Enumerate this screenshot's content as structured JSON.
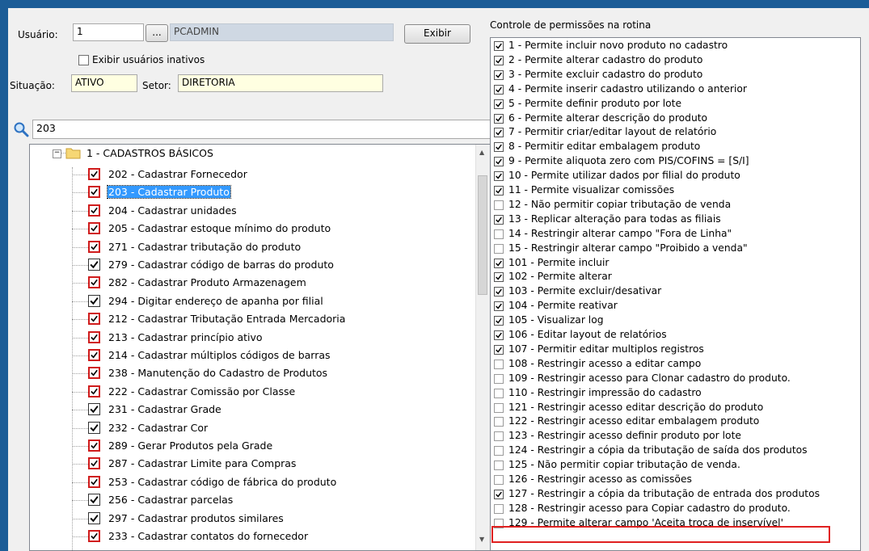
{
  "form": {
    "usuario_label": "Usuário:",
    "usuario_value": "1",
    "lookup_button": "...",
    "usuario_nome": "PCADMIN",
    "exibir_button": "Exibir",
    "inativos_label": "Exibir usuários inativos",
    "situacao_label": "Situação:",
    "situacao_value": "ATIVO",
    "setor_label": "Setor:",
    "setor_value": "DIRETORIA",
    "search_value": "203"
  },
  "tree": {
    "root_label": "1 - CADASTROS BÁSICOS",
    "items": [
      {
        "label": "202 - Cadastrar  Fornecedor",
        "red": true
      },
      {
        "label": "203 - Cadastrar  Produto",
        "red": true,
        "selected": true
      },
      {
        "label": "204 - Cadastrar unidades",
        "red": true
      },
      {
        "label": "205 - Cadastrar estoque mínimo do produto",
        "red": true
      },
      {
        "label": "271 - Cadastrar tributação do produto",
        "red": true
      },
      {
        "label": "279 - Cadastrar código de barras do produto",
        "red": false
      },
      {
        "label": "282 - Cadastrar Produto Armazenagem",
        "red": true
      },
      {
        "label": "294 - Digitar endereço de apanha por filial",
        "red": false
      },
      {
        "label": "212 - Cadastrar Tributação Entrada Mercadoria",
        "red": true
      },
      {
        "label": "213 - Cadastrar princípio ativo",
        "red": true
      },
      {
        "label": "214 - Cadastrar múltiplos códigos de barras",
        "red": true
      },
      {
        "label": "238 - Manutenção do Cadastro de Produtos",
        "red": true
      },
      {
        "label": "222 - Cadastrar Comissão por Classe",
        "red": true
      },
      {
        "label": "231 - Cadastrar Grade",
        "red": false
      },
      {
        "label": "232 - Cadastrar Cor",
        "red": false
      },
      {
        "label": "289 - Gerar Produtos pela Grade",
        "red": true
      },
      {
        "label": "287 - Cadastrar Limite para Compras",
        "red": true
      },
      {
        "label": "253 - Cadastrar código de fábrica do produto",
        "red": true
      },
      {
        "label": "256 - Cadastrar parcelas",
        "red": false
      },
      {
        "label": "297 - Cadastrar produtos similares",
        "red": false
      },
      {
        "label": "233 - Cadastrar contatos do fornecedor",
        "red": true
      }
    ]
  },
  "permissions": {
    "title": "Controle de permissões na rotina",
    "items": [
      {
        "label": "1 - Permite incluir novo produto no cadastro",
        "checked": true
      },
      {
        "label": "2 - Permite alterar cadastro do produto",
        "checked": true
      },
      {
        "label": "3 - Permite excluir cadastro do produto",
        "checked": true
      },
      {
        "label": "4 - Permite inserir cadastro utilizando o anterior",
        "checked": true
      },
      {
        "label": "5 - Permite definir produto por lote",
        "checked": true
      },
      {
        "label": "6 - Permite alterar descrição do produto",
        "checked": true
      },
      {
        "label": "7 - Permitir criar/editar layout de relatório",
        "checked": true
      },
      {
        "label": "8 - Permitir editar embalagem produto",
        "checked": true
      },
      {
        "label": "9 - Permite aliquota zero com PIS/COFINS = [S/I]",
        "checked": true
      },
      {
        "label": "10 - Permite utilizar dados por filial do produto",
        "checked": true
      },
      {
        "label": "11 - Permite visualizar comissões",
        "checked": true
      },
      {
        "label": "12 - Não permitir copiar tributação de venda",
        "checked": false
      },
      {
        "label": "13 - Replicar alteração para todas as filiais",
        "checked": true
      },
      {
        "label": "14 - Restringir alterar campo \"Fora de Linha\"",
        "checked": false
      },
      {
        "label": "15 - Restringir alterar campo \"Proibido a venda\"",
        "checked": false
      },
      {
        "label": "101 - Permite incluir",
        "checked": true
      },
      {
        "label": "102 - Permite alterar",
        "checked": true
      },
      {
        "label": "103 - Permite excluir/desativar",
        "checked": true
      },
      {
        "label": "104 - Permite reativar",
        "checked": true
      },
      {
        "label": "105 - Visualizar log",
        "checked": true
      },
      {
        "label": "106 - Editar layout de relatórios",
        "checked": true
      },
      {
        "label": "107 - Permitir editar multiplos registros",
        "checked": true
      },
      {
        "label": "108 - Restringir acesso a editar campo",
        "checked": false
      },
      {
        "label": "109 - Restringir acesso para Clonar cadastro do produto.",
        "checked": false
      },
      {
        "label": "110 - Restringir impressão do cadastro",
        "checked": false
      },
      {
        "label": "121 - Restringir acesso editar descrição do produto",
        "checked": false
      },
      {
        "label": "122 - Restringir acesso editar embalagem produto",
        "checked": false
      },
      {
        "label": "123 - Restringir acesso definir produto por lote",
        "checked": false
      },
      {
        "label": "124 - Restringir a cópia da tributação de saída dos produtos",
        "checked": false
      },
      {
        "label": "125 - Não permitir copiar tributação de venda.",
        "checked": false
      },
      {
        "label": "126 - Restringir acesso as comissões",
        "checked": false
      },
      {
        "label": "127 - Restringir a cópia da tributação de entrada dos produtos",
        "checked": true
      },
      {
        "label": "128 - Restringir acesso para Copiar cadastro do produto.",
        "checked": false
      },
      {
        "label": "129 - Permite alterar campo 'Aceita troca de inservível'",
        "checked": false
      }
    ]
  }
}
